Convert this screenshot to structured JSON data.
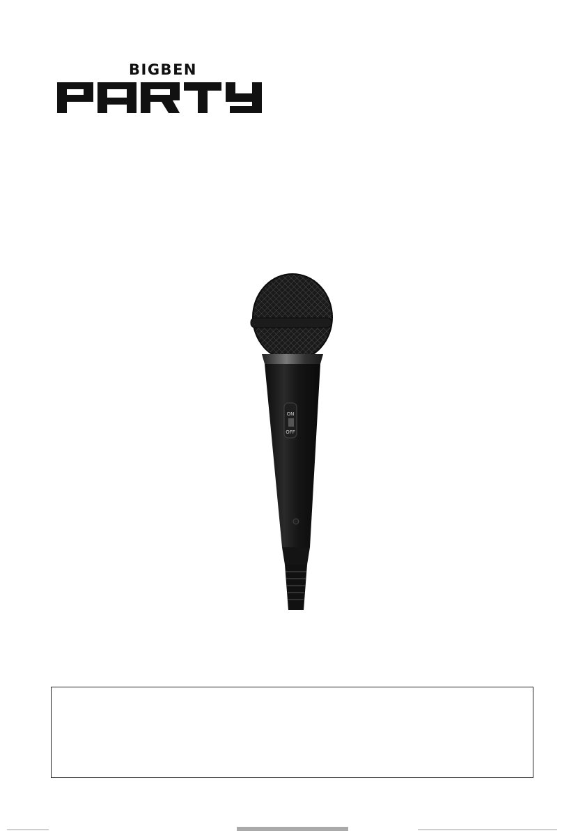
{
  "brand": {
    "top_text": "BIGBEN",
    "main_text": "PARTY",
    "color": "#111111"
  },
  "product": {
    "switch_on": "ON",
    "switch_off": "OFF",
    "body_color": "#151515"
  },
  "notice_box": {
    "text": ""
  }
}
